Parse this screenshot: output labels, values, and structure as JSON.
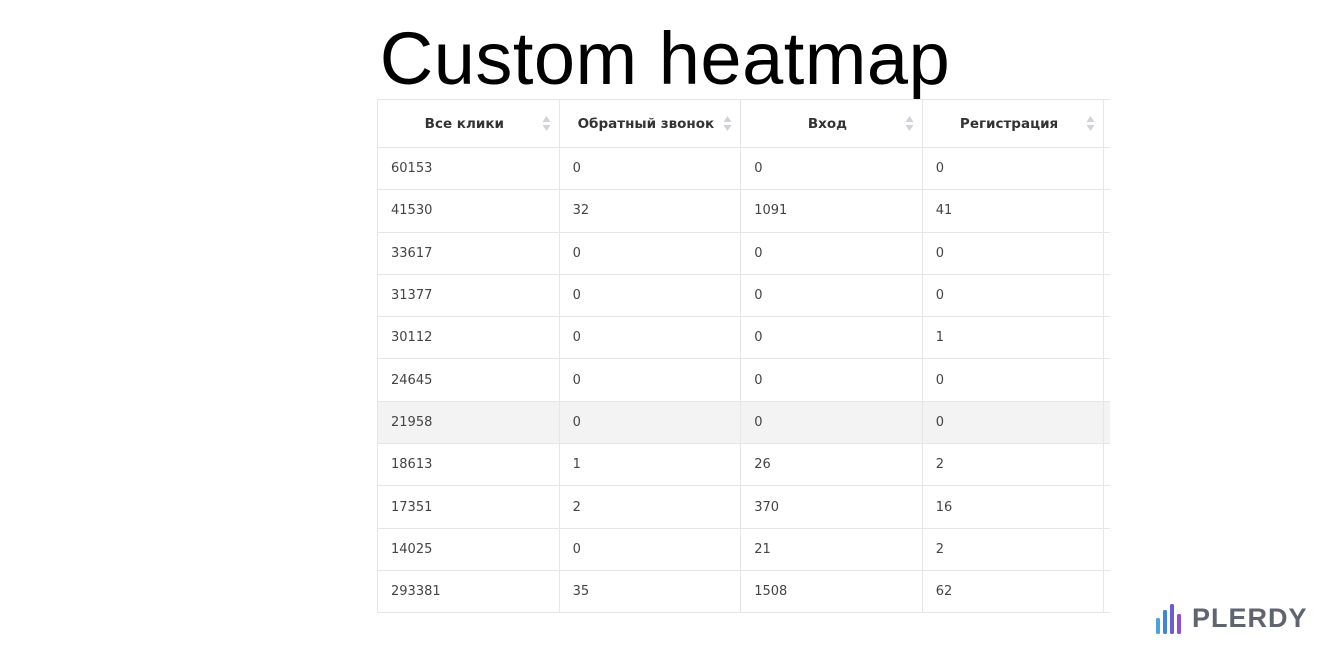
{
  "page": {
    "title": "Custom heatmap"
  },
  "table": {
    "columns": [
      {
        "label": "Все клики"
      },
      {
        "label": "Обратный звонок"
      },
      {
        "label": "Вход"
      },
      {
        "label": "Регистрация"
      }
    ],
    "rows": [
      {
        "cells": [
          {
            "v": "60153",
            "tone": "default"
          },
          {
            "v": "0",
            "tone": "default"
          },
          {
            "v": "0",
            "tone": "default"
          },
          {
            "v": "0",
            "tone": "default"
          }
        ]
      },
      {
        "cells": [
          {
            "v": "41530",
            "tone": "default"
          },
          {
            "v": "32",
            "tone": "blue"
          },
          {
            "v": "1091",
            "tone": "red"
          },
          {
            "v": "41",
            "tone": "blue"
          }
        ]
      },
      {
        "cells": [
          {
            "v": "33617",
            "tone": "default"
          },
          {
            "v": "0",
            "tone": "default"
          },
          {
            "v": "0",
            "tone": "default"
          },
          {
            "v": "0",
            "tone": "default"
          }
        ]
      },
      {
        "cells": [
          {
            "v": "31377",
            "tone": "default"
          },
          {
            "v": "0",
            "tone": "default"
          },
          {
            "v": "0",
            "tone": "default"
          },
          {
            "v": "0",
            "tone": "default"
          }
        ]
      },
      {
        "cells": [
          {
            "v": "30112",
            "tone": "default"
          },
          {
            "v": "0",
            "tone": "default"
          },
          {
            "v": "0",
            "tone": "default"
          },
          {
            "v": "1",
            "tone": "blue"
          }
        ]
      },
      {
        "cells": [
          {
            "v": "24645",
            "tone": "default"
          },
          {
            "v": "0",
            "tone": "default"
          },
          {
            "v": "0",
            "tone": "default"
          },
          {
            "v": "0",
            "tone": "default"
          }
        ]
      },
      {
        "highlighted": true,
        "cells": [
          {
            "v": "21958",
            "tone": "default"
          },
          {
            "v": "0",
            "tone": "default"
          },
          {
            "v": "0",
            "tone": "default"
          },
          {
            "v": "0",
            "tone": "default"
          }
        ]
      },
      {
        "cells": [
          {
            "v": "18613",
            "tone": "default"
          },
          {
            "v": "1",
            "tone": "blue"
          },
          {
            "v": "26",
            "tone": "red"
          },
          {
            "v": "2",
            "tone": "blue"
          }
        ]
      },
      {
        "cells": [
          {
            "v": "17351",
            "tone": "default"
          },
          {
            "v": "2",
            "tone": "blue"
          },
          {
            "v": "370",
            "tone": "red"
          },
          {
            "v": "16",
            "tone": "blue"
          }
        ]
      },
      {
        "cells": [
          {
            "v": "14025",
            "tone": "default"
          },
          {
            "v": "0",
            "tone": "default"
          },
          {
            "v": "21",
            "tone": "red"
          },
          {
            "v": "2",
            "tone": "blue"
          }
        ]
      },
      {
        "cells": [
          {
            "v": "293381",
            "tone": "default"
          },
          {
            "v": "35",
            "tone": "default"
          },
          {
            "v": "1508",
            "tone": "default"
          },
          {
            "v": "62",
            "tone": "default"
          }
        ]
      }
    ]
  },
  "logo": {
    "text": "PLERDY",
    "icon": "bar-chart-logo-icon"
  },
  "colors": {
    "blue_value": "#8a8cd8",
    "red_value": "#ee8c8c",
    "highlight_row": "#f3f3f3",
    "border": "#e4e6ea"
  }
}
